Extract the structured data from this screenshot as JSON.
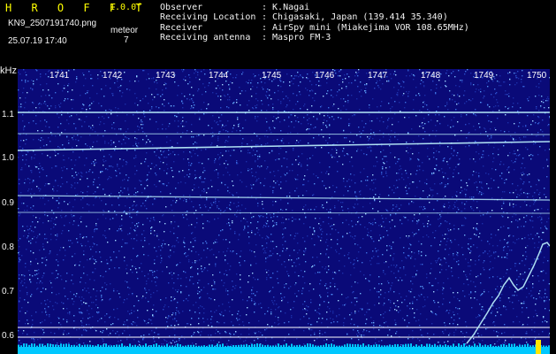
{
  "header": {
    "logo": "H R O F F T",
    "version": "1.0.0f",
    "filename": "KN9_2507191740.png",
    "datetime": "25.07.19 17:40",
    "meteor_label": "meteor",
    "meteor_count": "7",
    "info": [
      {
        "label": "Observer",
        "value": ": K.Nagai"
      },
      {
        "label": "Receiving Location",
        "value": ": Chigasaki, Japan (139.414 35.340)"
      },
      {
        "label": "Receiver",
        "value": ": AirSpy mini (Miakejima VOR 108.65MHz)"
      },
      {
        "label": "Receiving antenna",
        "value": ": Maspro FM-3"
      }
    ]
  },
  "spectrogram": {
    "y_unit": "kHz",
    "y_ticks": [
      "1.1",
      "1.0",
      "0.9",
      "0.8",
      "0.7",
      "0.6"
    ],
    "x_ticks": [
      "1741",
      "1742",
      "1743",
      "1744",
      "1745",
      "1746",
      "1747",
      "1748",
      "1749",
      "1750"
    ],
    "colors": {
      "background": "#0a0a78",
      "trace": "#bff5ff",
      "baseline": "#00c8ff",
      "marker": "#ffffff",
      "burst": "#ffe600"
    }
  }
}
